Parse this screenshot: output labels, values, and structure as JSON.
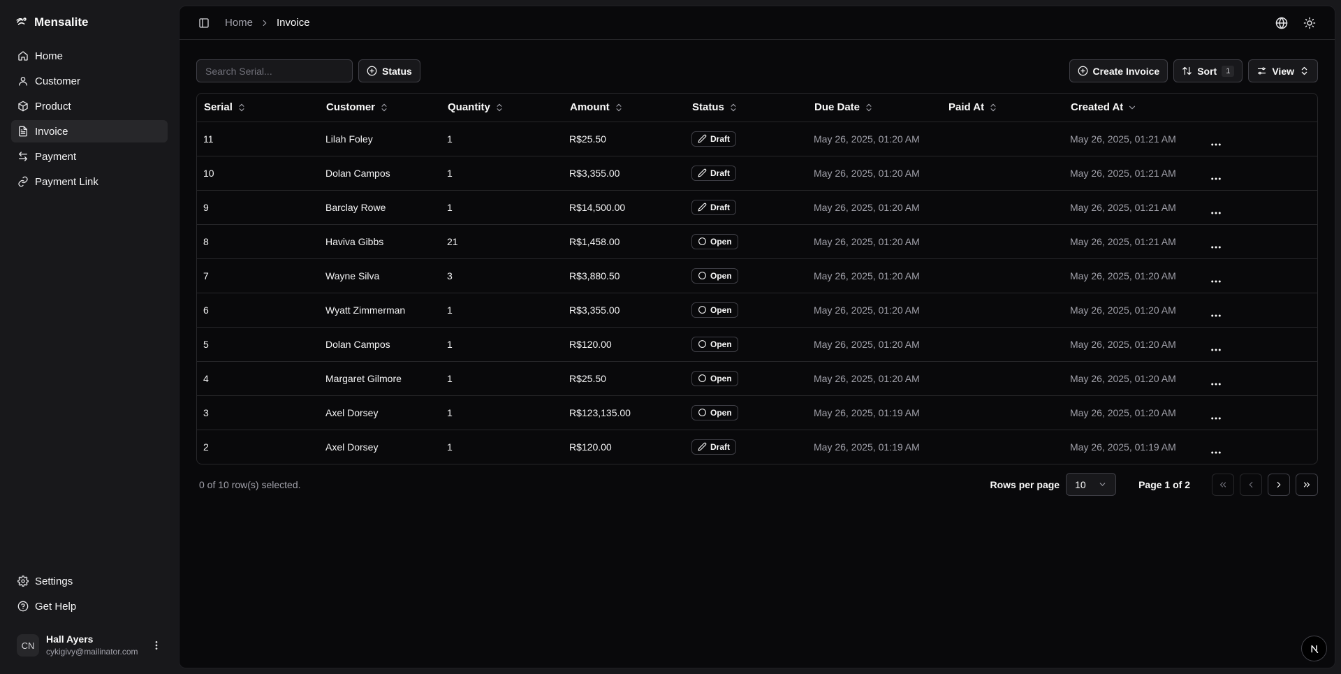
{
  "app": {
    "name": "Mensalite"
  },
  "sidebar": {
    "items": [
      {
        "label": "Home",
        "icon": "home-icon",
        "active": false
      },
      {
        "label": "Customer",
        "icon": "user-icon",
        "active": false
      },
      {
        "label": "Product",
        "icon": "package-icon",
        "active": false
      },
      {
        "label": "Invoice",
        "icon": "file-text-icon",
        "active": true
      },
      {
        "label": "Payment",
        "icon": "arrows-left-right-icon",
        "active": false
      },
      {
        "label": "Payment Link",
        "icon": "link-icon",
        "active": false
      }
    ],
    "bottom": [
      {
        "label": "Settings",
        "icon": "gear-icon"
      },
      {
        "label": "Get Help",
        "icon": "help-circle-icon"
      }
    ],
    "user": {
      "initials": "CN",
      "name": "Hall Ayers",
      "email": "cykigivy@mailinator.com"
    }
  },
  "header": {
    "breadcrumb": {
      "home": "Home",
      "current": "Invoice"
    }
  },
  "toolbar": {
    "search_placeholder": "Search Serial...",
    "status_filter": "Status",
    "create_label": "Create Invoice",
    "sort_label": "Sort",
    "sort_count": "1",
    "view_label": "View"
  },
  "table": {
    "columns": [
      "Serial",
      "Customer",
      "Quantity",
      "Amount",
      "Status",
      "Due Date",
      "Paid At",
      "Created At"
    ],
    "rows": [
      {
        "serial": "11",
        "customer": "Lilah Foley",
        "quantity": "1",
        "amount": "R$25.50",
        "status": "Draft",
        "due": "May 26, 2025, 01:20 AM",
        "paid": "",
        "created": "May 26, 2025, 01:21 AM"
      },
      {
        "serial": "10",
        "customer": "Dolan Campos",
        "quantity": "1",
        "amount": "R$3,355.00",
        "status": "Draft",
        "due": "May 26, 2025, 01:20 AM",
        "paid": "",
        "created": "May 26, 2025, 01:21 AM"
      },
      {
        "serial": "9",
        "customer": "Barclay Rowe",
        "quantity": "1",
        "amount": "R$14,500.00",
        "status": "Draft",
        "due": "May 26, 2025, 01:20 AM",
        "paid": "",
        "created": "May 26, 2025, 01:21 AM"
      },
      {
        "serial": "8",
        "customer": "Haviva Gibbs",
        "quantity": "21",
        "amount": "R$1,458.00",
        "status": "Open",
        "due": "May 26, 2025, 01:20 AM",
        "paid": "",
        "created": "May 26, 2025, 01:21 AM"
      },
      {
        "serial": "7",
        "customer": "Wayne Silva",
        "quantity": "3",
        "amount": "R$3,880.50",
        "status": "Open",
        "due": "May 26, 2025, 01:20 AM",
        "paid": "",
        "created": "May 26, 2025, 01:20 AM"
      },
      {
        "serial": "6",
        "customer": "Wyatt Zimmerman",
        "quantity": "1",
        "amount": "R$3,355.00",
        "status": "Open",
        "due": "May 26, 2025, 01:20 AM",
        "paid": "",
        "created": "May 26, 2025, 01:20 AM"
      },
      {
        "serial": "5",
        "customer": "Dolan Campos",
        "quantity": "1",
        "amount": "R$120.00",
        "status": "Open",
        "due": "May 26, 2025, 01:20 AM",
        "paid": "",
        "created": "May 26, 2025, 01:20 AM"
      },
      {
        "serial": "4",
        "customer": "Margaret Gilmore",
        "quantity": "1",
        "amount": "R$25.50",
        "status": "Open",
        "due": "May 26, 2025, 01:20 AM",
        "paid": "",
        "created": "May 26, 2025, 01:20 AM"
      },
      {
        "serial": "3",
        "customer": "Axel Dorsey",
        "quantity": "1",
        "amount": "R$123,135.00",
        "status": "Open",
        "due": "May 26, 2025, 01:19 AM",
        "paid": "",
        "created": "May 26, 2025, 01:20 AM"
      },
      {
        "serial": "2",
        "customer": "Axel Dorsey",
        "quantity": "1",
        "amount": "R$120.00",
        "status": "Draft",
        "due": "May 26, 2025, 01:19 AM",
        "paid": "",
        "created": "May 26, 2025, 01:19 AM"
      }
    ]
  },
  "footer": {
    "selected": "0 of 10 row(s) selected.",
    "rows_per_page_label": "Rows per page",
    "rows_per_page": "10",
    "page_info": "Page 1 of 2"
  }
}
